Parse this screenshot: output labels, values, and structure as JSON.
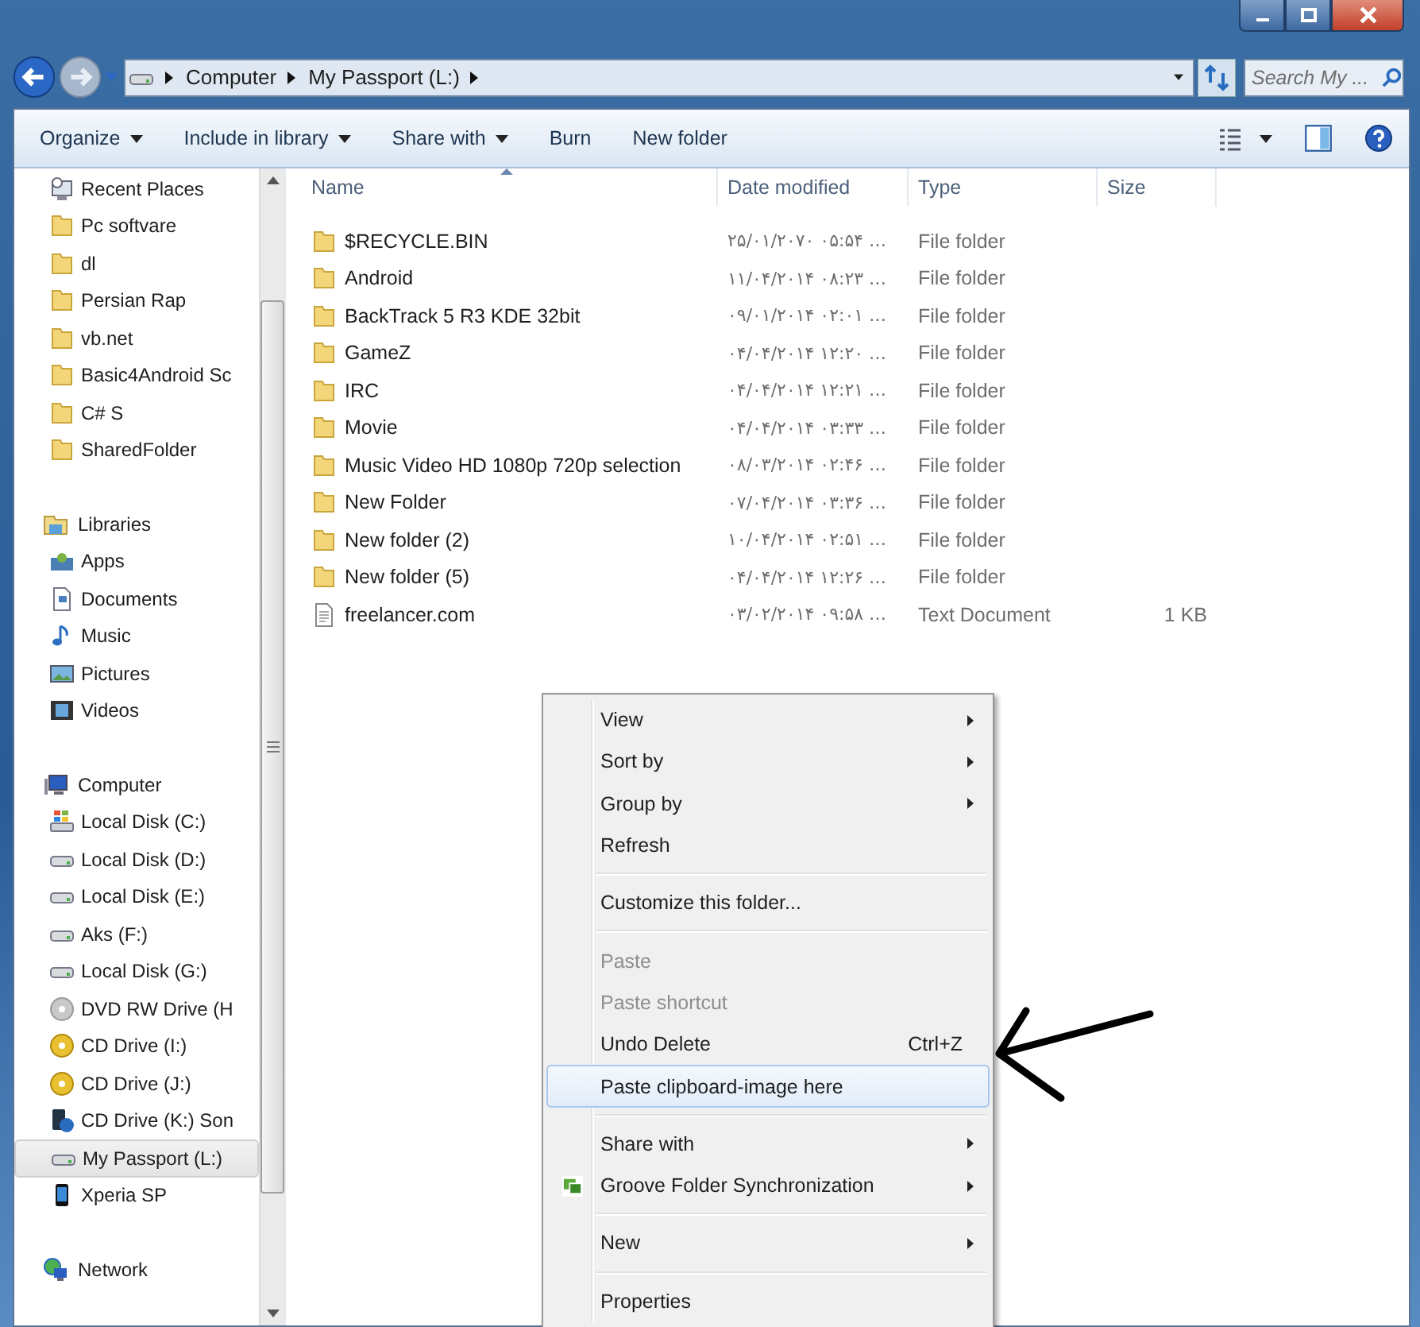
{
  "address": {
    "crumbs": [
      "Computer",
      "My Passport (L:)"
    ]
  },
  "search": {
    "placeholder": "Search My ..."
  },
  "toolbar": [
    {
      "label": "Organize",
      "dropdown": true
    },
    {
      "label": "Include in library",
      "dropdown": true
    },
    {
      "label": "Share with",
      "dropdown": true
    },
    {
      "label": "Burn",
      "dropdown": false
    },
    {
      "label": "New folder",
      "dropdown": false
    }
  ],
  "sidebar": {
    "sections": [
      {
        "items": [
          {
            "label": "Recent Places",
            "kind": "recent",
            "selected": false
          },
          {
            "label": "Pc softvare",
            "kind": "folder",
            "selected": false
          },
          {
            "label": "dl",
            "kind": "folder",
            "selected": false
          },
          {
            "label": "Persian Rap",
            "kind": "folder",
            "selected": false
          },
          {
            "label": "vb.net",
            "kind": "folder",
            "selected": false
          },
          {
            "label": "Basic4Android Sc",
            "kind": "folder",
            "selected": false
          },
          {
            "label": "C# S",
            "kind": "folder",
            "selected": false
          },
          {
            "label": "SharedFolder",
            "kind": "folder",
            "selected": false
          }
        ]
      },
      {
        "label": "Libraries",
        "kind": "library",
        "items": [
          {
            "label": "Apps",
            "kind": "apps",
            "selected": false
          },
          {
            "label": "Documents",
            "kind": "documents",
            "selected": false
          },
          {
            "label": "Music",
            "kind": "music",
            "selected": false
          },
          {
            "label": "Pictures",
            "kind": "pictures",
            "selected": false
          },
          {
            "label": "Videos",
            "kind": "videos",
            "selected": false
          }
        ]
      },
      {
        "label": "Computer",
        "kind": "computer",
        "items": [
          {
            "label": "Local Disk (C:)",
            "kind": "system-disk",
            "selected": false
          },
          {
            "label": "Local Disk (D:)",
            "kind": "disk",
            "selected": false
          },
          {
            "label": "Local Disk (E:)",
            "kind": "disk",
            "selected": false
          },
          {
            "label": "Aks (F:)",
            "kind": "disk",
            "selected": false
          },
          {
            "label": "Local Disk (G:)",
            "kind": "disk",
            "selected": false
          },
          {
            "label": "DVD RW Drive (H",
            "kind": "dvd",
            "selected": false
          },
          {
            "label": "CD Drive (I:)",
            "kind": "cd",
            "selected": false
          },
          {
            "label": "CD Drive (J:)",
            "kind": "cd",
            "selected": false
          },
          {
            "label": "CD Drive (K:) Son",
            "kind": "device",
            "selected": false
          },
          {
            "label": "My Passport (L:)",
            "kind": "disk",
            "selected": true
          },
          {
            "label": "Xperia SP",
            "kind": "phone",
            "selected": false
          }
        ]
      },
      {
        "label": "Network",
        "kind": "network"
      }
    ]
  },
  "table": {
    "columns": [
      {
        "label": "Name",
        "sorted": true
      },
      {
        "label": "Date modified",
        "sorted": false
      },
      {
        "label": "Type",
        "sorted": false
      },
      {
        "label": "Size",
        "sorted": false
      }
    ],
    "rows": [
      {
        "name": "$RECYCLE.BIN",
        "kind": "folder",
        "date": "۲۵/۰۱/۲۰۷۰ ۰۵:۵۴ …",
        "type": "File folder"
      },
      {
        "name": "Android",
        "kind": "folder",
        "date": "۱۱/۰۴/۲۰۱۴ ۰۸:۲۳ …",
        "type": "File folder"
      },
      {
        "name": "BackTrack 5 R3 KDE 32bit",
        "kind": "folder",
        "date": "۰۹/۰۱/۲۰۱۴ ۰۲:۰۱ …",
        "type": "File folder"
      },
      {
        "name": "GameZ",
        "kind": "folder",
        "date": "۰۴/۰۴/۲۰۱۴ ۱۲:۲۰ …",
        "type": "File folder"
      },
      {
        "name": "IRC",
        "kind": "folder",
        "date": "۰۴/۰۴/۲۰۱۴ ۱۲:۲۱ …",
        "type": "File folder"
      },
      {
        "name": "Movie",
        "kind": "folder",
        "date": "۰۴/۰۴/۲۰۱۴ ۰۳:۳۳ …",
        "type": "File folder"
      },
      {
        "name": "Music Video HD 1080p 720p selection",
        "kind": "folder",
        "date": "۰۸/۰۳/۲۰۱۴ ۰۲:۴۶ …",
        "type": "File folder"
      },
      {
        "name": "New Folder",
        "kind": "folder",
        "date": "۰۷/۰۴/۲۰۱۴ ۰۳:۳۶ …",
        "type": "File folder"
      },
      {
        "name": "New folder (2)",
        "kind": "folder",
        "date": "۱۰/۰۴/۲۰۱۴ ۰۲:۵۱ …",
        "type": "File folder"
      },
      {
        "name": "New folder (5)",
        "kind": "folder",
        "date": "۰۴/۰۴/۲۰۱۴ ۱۲:۲۶ …",
        "type": "File folder"
      },
      {
        "name": "freelancer.com",
        "kind": "text",
        "date": "۰۳/۰۲/۲۰۱۴ ۰۹:۵۸ …",
        "type": "Text Document",
        "size": "1 KB"
      }
    ]
  },
  "context_menu": {
    "sections": [
      [
        {
          "label": "View",
          "submenu": true,
          "disabled": false,
          "selected": false
        },
        {
          "label": "Sort by",
          "submenu": true,
          "disabled": false,
          "selected": false
        },
        {
          "label": "Group by",
          "submenu": true,
          "disabled": false,
          "selected": false
        },
        {
          "label": "Refresh",
          "submenu": false,
          "disabled": false,
          "selected": false
        }
      ],
      [
        {
          "label": "Customize this folder...",
          "submenu": false,
          "disabled": false,
          "selected": false
        }
      ],
      [
        {
          "label": "Paste",
          "submenu": false,
          "disabled": true,
          "selected": false
        },
        {
          "label": "Paste shortcut",
          "submenu": false,
          "disabled": true,
          "selected": false
        },
        {
          "label": "Undo Delete",
          "submenu": false,
          "disabled": false,
          "selected": false,
          "shortcut": "Ctrl+Z"
        },
        {
          "label": "Paste clipboard-image here",
          "submenu": false,
          "disabled": false,
          "selected": true
        }
      ],
      [
        {
          "label": "Share with",
          "submenu": true,
          "disabled": false,
          "selected": false
        },
        {
          "label": "Groove Folder Synchronization",
          "submenu": true,
          "disabled": false,
          "selected": false,
          "has_icon": true
        }
      ],
      [
        {
          "label": "New",
          "submenu": true,
          "disabled": false,
          "selected": false
        }
      ],
      [
        {
          "label": "Properties",
          "submenu": false,
          "disabled": false,
          "selected": false
        }
      ]
    ]
  }
}
